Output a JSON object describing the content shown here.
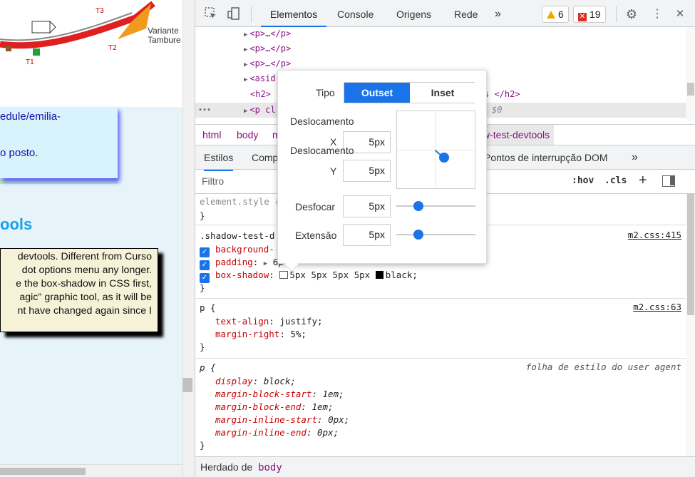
{
  "page": {
    "map_labels": {
      "variante": "Variante",
      "tambure": "Tambure",
      "t1": "T1",
      "t2": "T2",
      "t3": "T3"
    },
    "link_text_1": "edule/emilia-",
    "link_text_2": "o posto.",
    "heading": "ools",
    "yellow_lines": [
      "devtools. Different from Curso",
      "dot options menu any longer.",
      "e the box-shadow in CSS first,",
      "agic\" graphic tool, as it will be",
      "nt have changed again since I"
    ]
  },
  "toolbar": {
    "tabs": [
      "Elementos",
      "Console",
      "Origens",
      "Rede"
    ],
    "more": "»",
    "warnings": "6",
    "errors": "19"
  },
  "elements": {
    "rows": [
      {
        "text": "<p>…</p>"
      },
      {
        "text": "<p>…</p>"
      },
      {
        "text": "<p>…</p>"
      },
      {
        "text": "<asid"
      },
      {
        "text": "<h2>"
      },
      {
        "text": "<p cl"
      }
    ],
    "h2_tail": "s </h2>",
    "selected_marker": "$0",
    "dots": "•••"
  },
  "breadcrumbs": [
    "html",
    "body",
    "m",
    "w-test-devtools"
  ],
  "subtabs": {
    "styles": "Estilos",
    "computed": "Comp",
    "dom_breakpoints": "Pontos de interrupção DOM",
    "more": "»"
  },
  "filter": {
    "placeholder": "Filtro",
    "hov": ":hov",
    "cls": ".cls",
    "plus": "+"
  },
  "styles": {
    "element_style": "element.style {",
    "close": "}",
    "rule1": {
      "selector": ".shadow-test-d",
      "source": "m2.css:415",
      "p1": "background-",
      "p2": "padding",
      "p2val": "6p",
      "p3": "box-shadow",
      "p3val": "5px 5px 5px 5px",
      "p3color": "black;"
    },
    "rule2": {
      "selector": "p {",
      "source": "m2.css:63",
      "p1": "text-align",
      "v1": "justify;",
      "p2": "margin-right",
      "v2": "5%;"
    },
    "rule3": {
      "selector": "p {",
      "source": "folha de estilo do user agent",
      "p1": "display",
      "v1": "block;",
      "p2": "margin-block-start",
      "v2": "1em;",
      "p3": "margin-block-end",
      "v3": "1em;",
      "p4": "margin-inline-start",
      "v4": "0px;",
      "p5": "margin-inline-end",
      "v5": "0px;"
    },
    "inherited_label": "Herdado de",
    "inherited_from": "body"
  },
  "shadow_editor": {
    "type_label": "Tipo",
    "outset": "Outset",
    "inset": "Inset",
    "offset_label_1": "Deslocamento",
    "x_label": "X",
    "x_value": "5px",
    "offset_label_2": "Deslocamento",
    "y_label": "Y",
    "y_value": "5px",
    "blur_label": "Desfocar",
    "blur_value": "5px",
    "spread_label": "Extensão",
    "spread_value": "5px"
  }
}
